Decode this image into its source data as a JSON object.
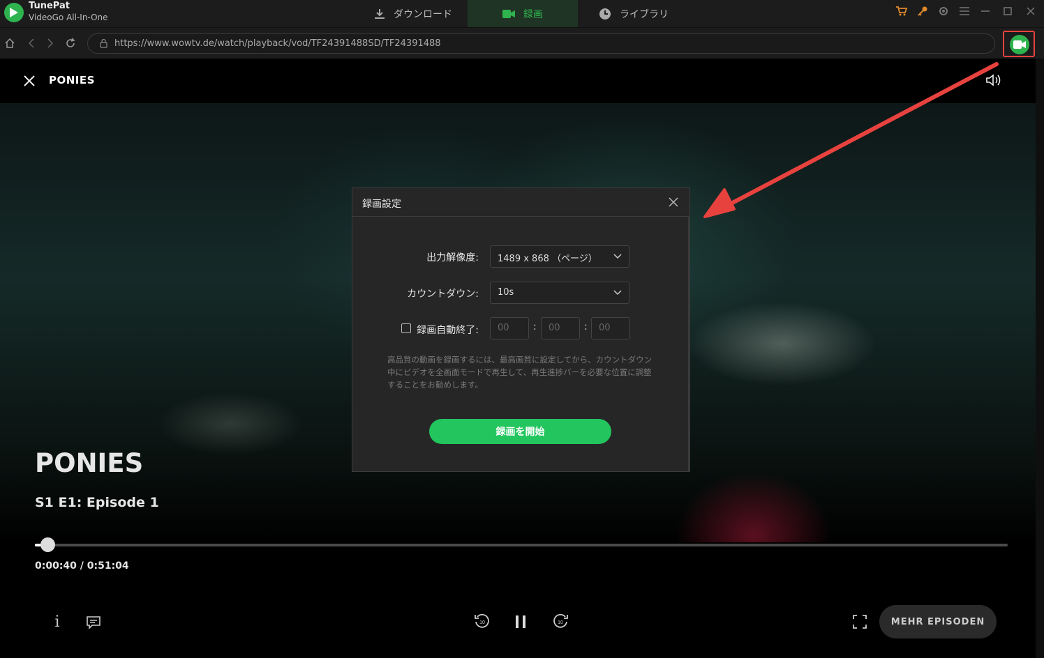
{
  "app": {
    "name": "TunePat",
    "subtitle": "VideoGo All-In-One"
  },
  "tabs": [
    {
      "label": "ダウンロード",
      "icon": "download-icon"
    },
    {
      "label": "録画",
      "icon": "video-camera-icon",
      "active": true
    },
    {
      "label": "ライブラリ",
      "icon": "clock-icon"
    }
  ],
  "window_controls": [
    "cart-icon",
    "key-icon",
    "gear-icon",
    "menu-icon",
    "minimize-icon",
    "maximize-icon",
    "close-icon"
  ],
  "address": {
    "url": "https://www.wowtv.de/watch/playback/vod/TF24391488SD/TF24391488"
  },
  "player": {
    "header_title": "PONIES",
    "show_title": "PONIES",
    "episode": "S1 E1: Episode 1",
    "time": "0:00:40 / 0:51:04",
    "progress_fraction": 0.013,
    "more_episodes": "MEHR EPISODEN",
    "info_label": "i"
  },
  "dialog": {
    "title": "録画設定",
    "resolution_label": "出力解像度:",
    "resolution_value": "1489 x 868 （ページ）",
    "countdown_label": "カウントダウン:",
    "countdown_value": "10s",
    "autostop_label": "録画自動終了:",
    "autostop_checked": false,
    "time_placeholders": [
      "00",
      "00",
      "00"
    ],
    "colon": ":",
    "hint": "高品質の動画を録画するには、最高画質に設定してから、カウントダウン中にビデオを全画面モードで再生して、再生進捗バーを必要な位置に調整することをお勧めします。",
    "start_button": "録画を開始"
  },
  "colors": {
    "accent_green": "#2fb34f",
    "button_green": "#22c55e",
    "highlight_red": "#e8423f"
  }
}
